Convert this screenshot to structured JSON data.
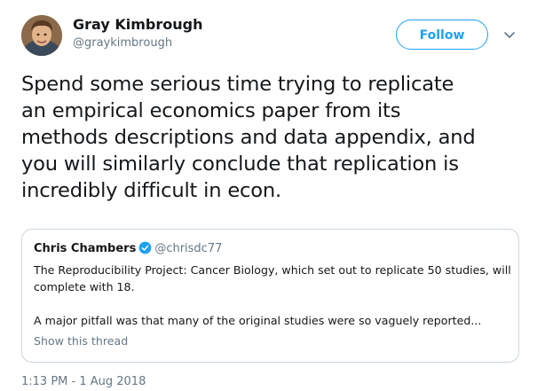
{
  "author": {
    "display_name": "Gray Kimbrough",
    "handle": "@graykimbrough",
    "avatar_icon": "avatar"
  },
  "actions": {
    "follow_label": "Follow",
    "caret_icon": "chevron-down-icon"
  },
  "tweet": {
    "text_lines": [
      "Spend some serious time trying to replicate",
      "an empirical economics paper from its",
      "methods descriptions and data appendix, and",
      "you will similarly conclude that replication is",
      "incredibly difficult in econ."
    ]
  },
  "quoted_tweet": {
    "display_name": "Chris Chambers",
    "verified_icon": "verified-badge-icon",
    "handle": "@chrisdc77",
    "text_lines": [
      "The Reproducibility Project: Cancer Biology, which set out to replicate 50 studies, will",
      "complete with 18.",
      "",
      "A major pitfall was that many of the original studies were so vaguely reported..."
    ],
    "show_thread_label": "Show this thread"
  },
  "timestamp": "1:13 PM - 1 Aug 2018",
  "colors": {
    "accent": "#1da1f2",
    "text": "#14171a",
    "secondary_text": "#657786",
    "border": "#ccd6dd"
  }
}
